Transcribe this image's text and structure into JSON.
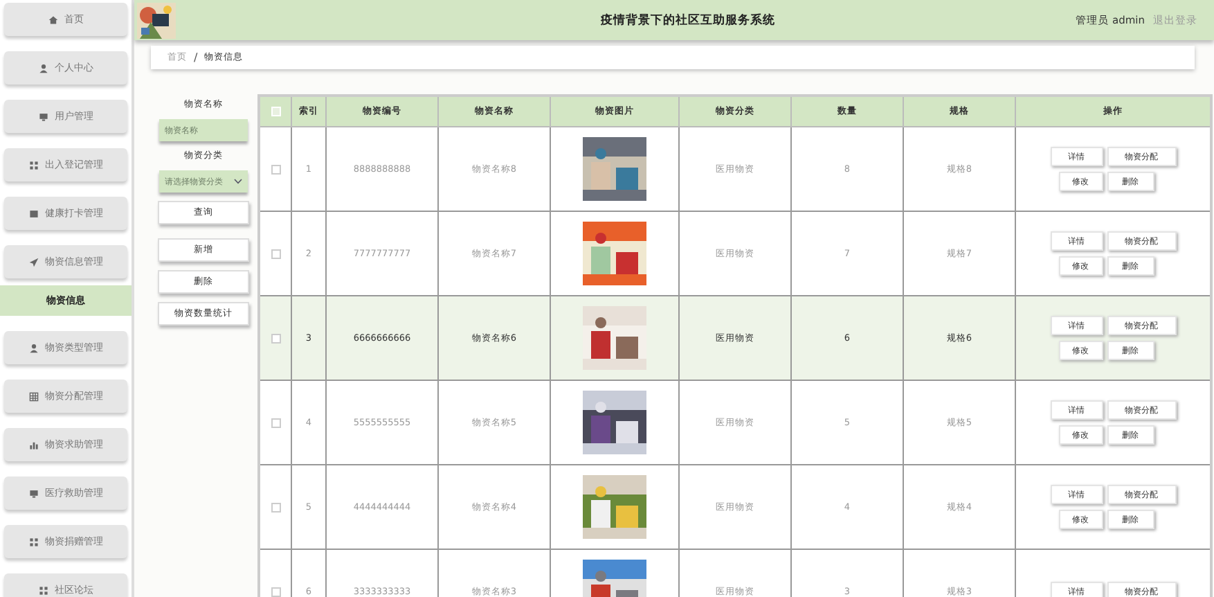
{
  "sidebar": {
    "items": [
      {
        "label": "首页",
        "selected": false
      },
      {
        "label": "个人中心",
        "selected": false
      },
      {
        "label": "用户管理",
        "selected": false
      },
      {
        "label": "出入登记管理",
        "selected": false
      },
      {
        "label": "健康打卡管理",
        "selected": false
      },
      {
        "label": "物资信息管理",
        "selected": false,
        "children": [
          {
            "label": "物资信息",
            "selected": true
          }
        ]
      },
      {
        "label": "物资类型管理",
        "selected": false
      },
      {
        "label": "物资分配管理",
        "selected": false
      },
      {
        "label": "物资求助管理",
        "selected": false
      },
      {
        "label": "医疗救助管理",
        "selected": false
      },
      {
        "label": "物资捐赠管理",
        "selected": false
      },
      {
        "label": "社区论坛",
        "selected": false
      }
    ]
  },
  "header": {
    "title": "疫情背景下的社区互助服务系统",
    "user": "管理员 admin",
    "logout": "退出登录"
  },
  "breadcrumb": {
    "home": "首页",
    "separator": "/",
    "current": "物资信息"
  },
  "filters": {
    "name_label": "物资名称",
    "name_placeholder": "物资名称",
    "category_label": "物资分类",
    "category_placeholder": "请选择物资分类",
    "buttons": [
      "查询",
      "新增",
      "删除",
      "物资数量统计"
    ]
  },
  "table": {
    "select_all_checked": false,
    "columns": [
      "索引",
      "物资编号",
      "物资名称",
      "物资图片",
      "物资分类",
      "数量",
      "规格",
      "操作"
    ],
    "rows": [
      {
        "index": "1",
        "code": "8888888888",
        "name": "物资名称8",
        "category": "医用物资",
        "quantity": "8",
        "spec": "规格8",
        "checked": false,
        "highlighted": false,
        "actions": [
          "详情",
          "物资分配",
          "修改",
          "删除"
        ]
      },
      {
        "index": "2",
        "code": "7777777777",
        "name": "物资名称7",
        "category": "医用物资",
        "quantity": "7",
        "spec": "规格7",
        "checked": false,
        "highlighted": false,
        "actions": [
          "详情",
          "物资分配",
          "修改",
          "删除"
        ]
      },
      {
        "index": "3",
        "code": "6666666666",
        "name": "物资名称6",
        "category": "医用物资",
        "quantity": "6",
        "spec": "规格6",
        "checked": false,
        "highlighted": true,
        "actions": [
          "详情",
          "物资分配",
          "修改",
          "删除"
        ]
      },
      {
        "index": "4",
        "code": "5555555555",
        "name": "物资名称5",
        "category": "医用物资",
        "quantity": "5",
        "spec": "规格5",
        "checked": false,
        "highlighted": false,
        "actions": [
          "详情",
          "物资分配",
          "修改",
          "删除"
        ]
      },
      {
        "index": "5",
        "code": "4444444444",
        "name": "物资名称4",
        "category": "医用物资",
        "quantity": "4",
        "spec": "规格4",
        "checked": false,
        "highlighted": false,
        "actions": [
          "详情",
          "物资分配",
          "修改",
          "删除"
        ]
      },
      {
        "index": "6",
        "code": "3333333333",
        "name": "物资名称3",
        "category": "医用物资",
        "quantity": "3",
        "spec": "规格3",
        "checked": false,
        "highlighted": false,
        "actions": [
          "详情",
          "物资分配"
        ]
      }
    ]
  }
}
